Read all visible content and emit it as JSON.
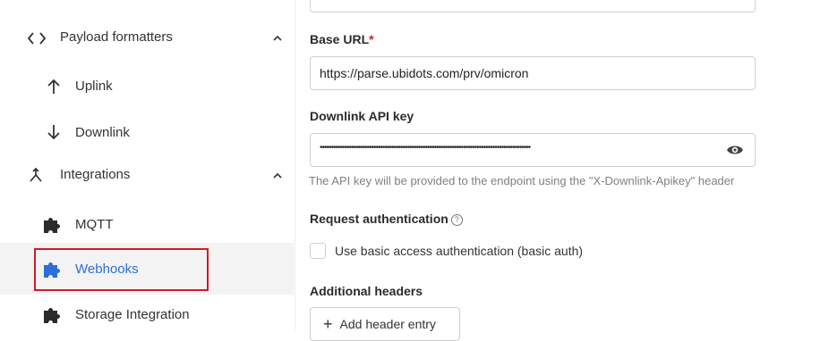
{
  "sidebar": {
    "items": [
      {
        "label": "Payload formatters",
        "icon": "code-brackets-icon"
      },
      {
        "label": "Uplink",
        "icon": "arrow-up-icon"
      },
      {
        "label": "Downlink",
        "icon": "arrow-down-icon"
      },
      {
        "label": "Integrations",
        "icon": "integrations-merge-icon"
      },
      {
        "label": "MQTT",
        "icon": "puzzle-icon"
      },
      {
        "label": "Webhooks",
        "icon": "puzzle-icon"
      },
      {
        "label": "Storage Integration",
        "icon": "puzzle-icon"
      }
    ],
    "active_item": "Webhooks"
  },
  "form": {
    "base_url": {
      "label": "Base URL",
      "required_mark": "*",
      "value": "https://parse.ubidots.com/prv/omicron"
    },
    "downlink_api_key": {
      "label": "Downlink API key",
      "masked_value": "••••••••••••••••••••••••••••••••••••••••••••••••••••••••••••••••••••••••••••••••••••••••••••••",
      "help": "The API key will be provided to the endpoint using the \"X-Downlink-Apikey\" header"
    },
    "request_authentication": {
      "label": "Request authentication",
      "checkbox_label": "Use basic access authentication (basic auth)",
      "checked": false
    },
    "additional_headers": {
      "label": "Additional headers",
      "add_button_label": "Add header entry"
    }
  },
  "colors": {
    "accent": "#2c6fd6",
    "highlight_border": "#d11a2a",
    "puzzle_icon": "#2b2b2b",
    "active_puzzle_icon": "#2c6fd6"
  }
}
